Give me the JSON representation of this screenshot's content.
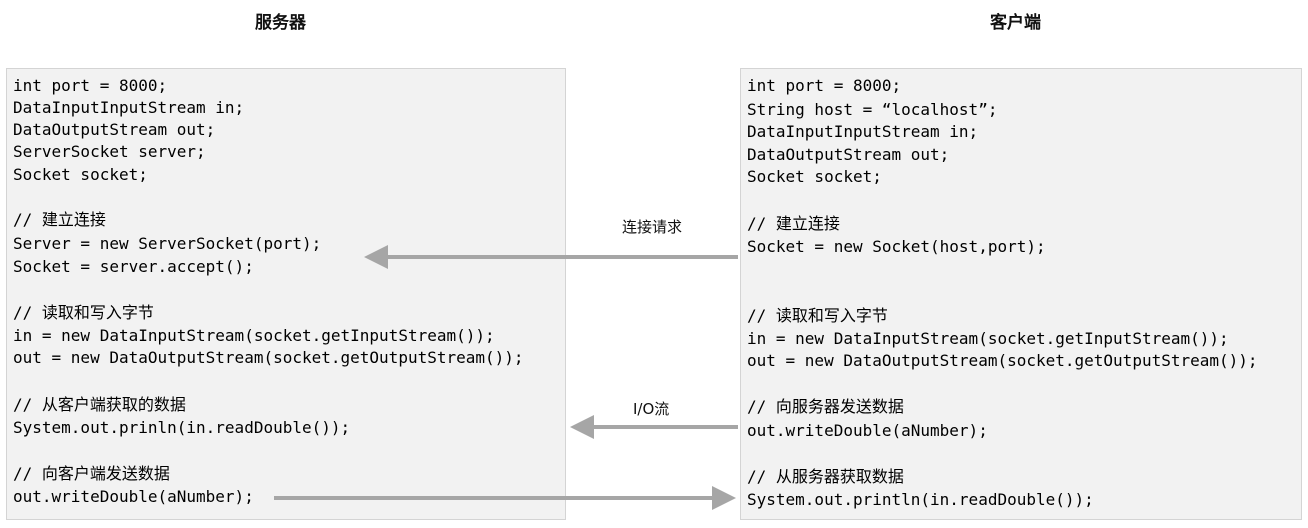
{
  "headings": {
    "server": "服务器",
    "client": "客户端"
  },
  "server_code": [
    "int port = 8000;",
    "DataInputInputStream in;",
    "DataOutputStream out;",
    "ServerSocket server;",
    "Socket socket;",
    "",
    "// 建立连接",
    "Server = new ServerSocket(port);",
    "Socket = server.accept();",
    "",
    "// 读取和写入字节",
    "in = new DataInputStream(socket.getInputStream());",
    "out = new DataOutputStream(socket.getOutputStream());",
    "",
    "// 从客户端获取的数据",
    "System.out.prinln(in.readDouble());",
    "",
    "// 向客户端发送数据",
    "out.writeDouble(aNumber);"
  ],
  "client_code": [
    "int port = 8000;",
    "String host = “localhost”;",
    "DataInputInputStream in;",
    "DataOutputStream out;",
    "Socket socket;",
    "",
    "// 建立连接",
    "Socket = new Socket(host,port);",
    "",
    "",
    "// 读取和写入字节",
    "in = new DataInputStream(socket.getInputStream());",
    "out = new DataOutputStream(socket.getOutputStream());",
    "",
    "// 向服务器发送数据",
    "out.writeDouble(aNumber);",
    "",
    "// 从服务器获取数据",
    "System.out.println(in.readDouble());"
  ],
  "arrows": {
    "connection_label": "连接请求",
    "io_label": "I/O流"
  },
  "colors": {
    "panel_background": "#f2f2f2",
    "panel_border": "#d4d4d4",
    "arrow": "#a6a6a6"
  }
}
